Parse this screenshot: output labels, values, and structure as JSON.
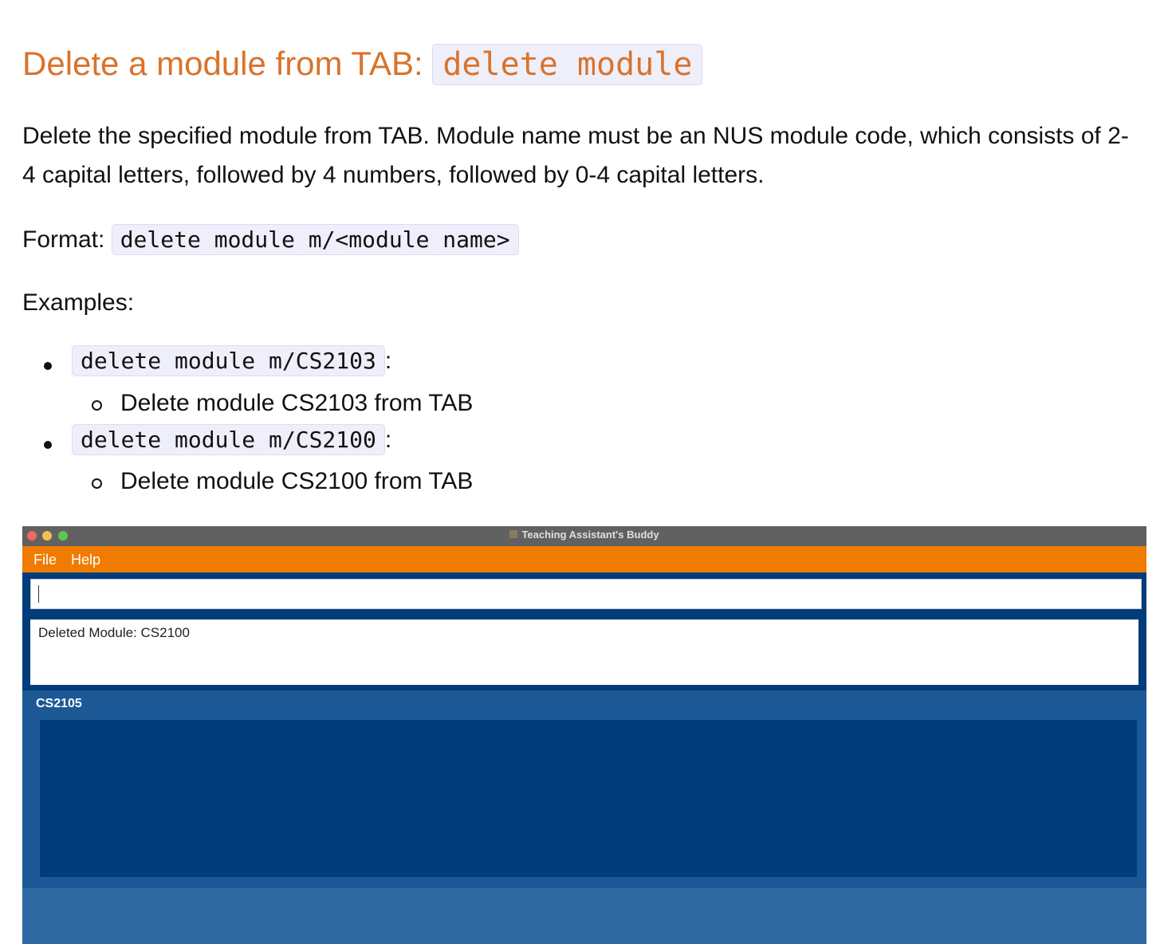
{
  "heading": {
    "text": "Delete a module from TAB:",
    "code": "delete module"
  },
  "description": "Delete the specified module from TAB. Module name must be an NUS module code, which consists of 2-4 capital letters, followed by 4 numbers, followed by 0-4 capital letters.",
  "format": {
    "label": "Format:",
    "code": "delete module m/<module name>"
  },
  "examples_label": "Examples:",
  "examples": [
    {
      "code": "delete module m/CS2103",
      "suffix": ":",
      "desc": "Delete module CS2103 from TAB"
    },
    {
      "code": "delete module m/CS2100",
      "suffix": ":",
      "desc": "Delete module CS2100 from TAB"
    }
  ],
  "app": {
    "title": "Teaching Assistant's Buddy",
    "menu": [
      "File",
      "Help"
    ],
    "command_value": "",
    "result": "Deleted Module: CS2100",
    "module_tab": "CS2105",
    "colors": {
      "menu": "#ef7b00",
      "background": "#003d7a",
      "panel": "#1d5896"
    }
  }
}
